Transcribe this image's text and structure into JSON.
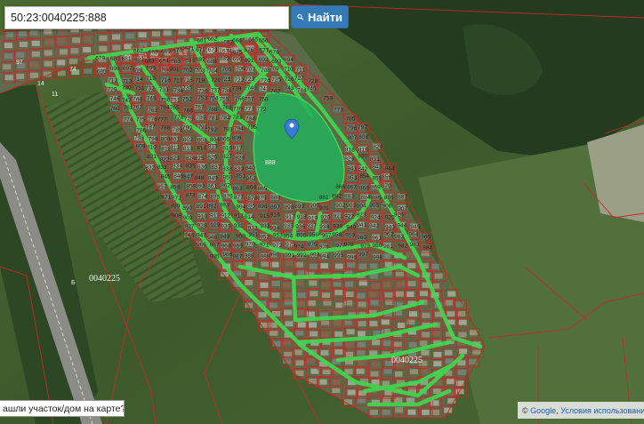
{
  "search": {
    "value": "50:23:0040225:888",
    "button_label": "Найти"
  },
  "map": {
    "pin_parcel_label": "888",
    "cadastral_block_label": "0040225",
    "cadastral_block_label_2": "0040225",
    "road_label": "Б",
    "side_labels": [
      "97",
      "74",
      "11",
      "14"
    ],
    "plot_labels": [
      "661",
      "662",
      "663",
      "664",
      "665",
      "666",
      "667",
      "668",
      "669",
      "670",
      "671",
      "672",
      "673",
      "674",
      "675",
      "676",
      "677",
      "678",
      "679",
      "680",
      "681",
      "682",
      "683",
      "684",
      "685",
      "686",
      "687",
      "688",
      "689",
      "690",
      "691",
      "692",
      "693",
      "694",
      "695",
      "696",
      "697",
      "698",
      "699",
      "700",
      "701",
      "702",
      "703",
      "704",
      "705",
      "706",
      "707",
      "708",
      "709",
      "710",
      "711",
      "712",
      "713",
      "714",
      "715",
      "716",
      "717",
      "718",
      "719",
      "720",
      "721",
      "722",
      "723",
      "724",
      "725",
      "726",
      "727",
      "728",
      "729",
      "730",
      "731",
      "732",
      "733",
      "734",
      "735",
      "736",
      "737",
      "738",
      "739",
      "740",
      "741",
      "742",
      "743",
      "744",
      "745",
      "746",
      "747",
      "748",
      "749",
      "750",
      "751",
      "752",
      "753",
      "754",
      "755",
      "756",
      "757",
      "758",
      "759",
      "760",
      "761",
      "762",
      "763",
      "764",
      "765",
      "766",
      "767",
      "768",
      "769",
      "770",
      "771",
      "772",
      "773",
      "774",
      "775",
      "776",
      "777",
      "778",
      "779",
      "780",
      "781",
      "782",
      "783",
      "784",
      "785",
      "786",
      "787",
      "788",
      "789",
      "790",
      "791",
      "792",
      "793",
      "794",
      "795",
      "796",
      "797",
      "798",
      "799",
      "800",
      "801",
      "802",
      "803",
      "804",
      "805",
      "806",
      "807",
      "808",
      "809",
      "810",
      "811",
      "812",
      "813",
      "814",
      "815",
      "816",
      "817",
      "818",
      "819",
      "820",
      "821",
      "822",
      "823",
      "824",
      "825",
      "826",
      "827",
      "828",
      "829",
      "830",
      "831",
      "832",
      "833",
      "834",
      "835",
      "836",
      "837",
      "838",
      "839",
      "840",
      "841",
      "842",
      "843",
      "844",
      "845",
      "846",
      "847",
      "848",
      "849",
      "850",
      "851",
      "852",
      "853",
      "854",
      "855",
      "856",
      "857",
      "858",
      "859",
      "860",
      "861",
      "862",
      "863",
      "864",
      "865",
      "866",
      "867",
      "868",
      "869",
      "870",
      "871",
      "872",
      "873",
      "874",
      "875",
      "876",
      "877",
      "878",
      "879",
      "880",
      "881",
      "882",
      "883",
      "884",
      "885",
      "886",
      "887",
      "889",
      "890",
      "891",
      "892",
      "893",
      "894",
      "895",
      "896",
      "897",
      "898",
      "899",
      "900",
      "901",
      "902",
      "903",
      "904",
      "905",
      "906",
      "907",
      "908",
      "909",
      "910",
      "911",
      "912",
      "913",
      "914",
      "915",
      "916",
      "917",
      "918",
      "919",
      "920",
      "921",
      "922",
      "923",
      "924",
      "925",
      "926",
      "927",
      "928",
      "929",
      "930",
      "931",
      "932",
      "933",
      "934",
      "935",
      "936",
      "937",
      "938",
      "939",
      "940",
      "941",
      "942",
      "943",
      "944",
      "945",
      "946",
      "947",
      "948",
      "949",
      "950",
      "951",
      "952",
      "953",
      "954",
      "955",
      "956",
      "957",
      "958",
      "959",
      "960",
      "961",
      "962",
      "963",
      "964",
      "965",
      "966",
      "967",
      "968",
      "969",
      "970",
      "971",
      "972",
      "973",
      "974",
      "975",
      "976",
      "977",
      "978",
      "979",
      "980",
      "981",
      "982",
      "983",
      "984",
      "985",
      "986",
      "987",
      "988",
      "989",
      "990",
      "991",
      "992",
      "993",
      "994",
      "995",
      "996",
      "997",
      "998"
    ]
  },
  "bottom_prompt": "ашли участок/дом на карте?",
  "attribution": {
    "copyright": "©",
    "google": "Google",
    "terms": "Условия использовани"
  },
  "colors": {
    "accent_blue": "#337ab7",
    "parcel_outline": "#c62828",
    "road_green": "#3fd84f",
    "selected_fill": "#21b25a"
  }
}
